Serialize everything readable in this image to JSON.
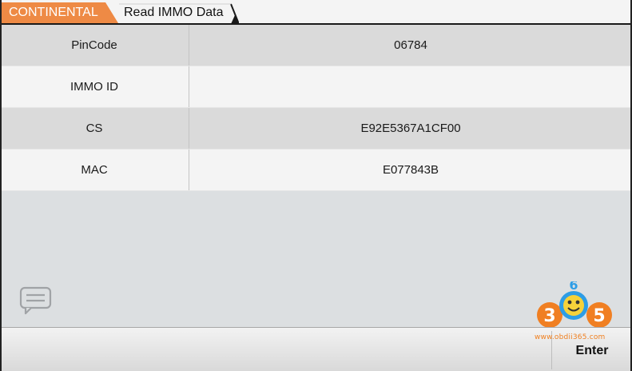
{
  "breadcrumb": {
    "items": [
      {
        "label": "CONTINENTAL",
        "color": "#ee8a45"
      },
      {
        "label": "Read IMMO Data"
      }
    ]
  },
  "table": {
    "rows": [
      {
        "key": "PinCode",
        "value": "06784"
      },
      {
        "key": "IMMO ID",
        "value": ""
      },
      {
        "key": "CS",
        "value": "E92E5367A1CF00"
      },
      {
        "key": "MAC",
        "value": "E077843B"
      }
    ]
  },
  "icons": {
    "message": "message-icon"
  },
  "watermark": {
    "digits": [
      "3",
      "6",
      "5"
    ],
    "url": "www.obdii365.com"
  },
  "footer": {
    "enter_label": "Enter"
  }
}
